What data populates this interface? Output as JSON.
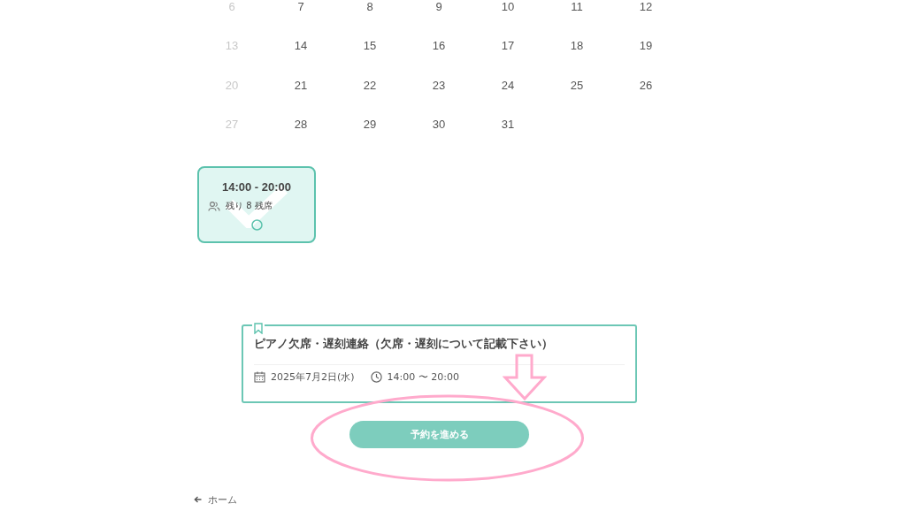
{
  "calendar": {
    "days": [
      {
        "label": "6",
        "disabled": true
      },
      {
        "label": "7",
        "disabled": false
      },
      {
        "label": "8",
        "disabled": false
      },
      {
        "label": "9",
        "disabled": false
      },
      {
        "label": "10",
        "disabled": false
      },
      {
        "label": "11",
        "disabled": false
      },
      {
        "label": "12",
        "disabled": false
      },
      {
        "label": "13",
        "disabled": true
      },
      {
        "label": "14",
        "disabled": false
      },
      {
        "label": "15",
        "disabled": false
      },
      {
        "label": "16",
        "disabled": false
      },
      {
        "label": "17",
        "disabled": false
      },
      {
        "label": "18",
        "disabled": false
      },
      {
        "label": "19",
        "disabled": false
      },
      {
        "label": "20",
        "disabled": true
      },
      {
        "label": "21",
        "disabled": false
      },
      {
        "label": "22",
        "disabled": false
      },
      {
        "label": "23",
        "disabled": false
      },
      {
        "label": "24",
        "disabled": false
      },
      {
        "label": "25",
        "disabled": false
      },
      {
        "label": "26",
        "disabled": false
      },
      {
        "label": "27",
        "disabled": true
      },
      {
        "label": "28",
        "disabled": false
      },
      {
        "label": "29",
        "disabled": false
      },
      {
        "label": "30",
        "disabled": false
      },
      {
        "label": "31",
        "disabled": false
      }
    ]
  },
  "time_slot": {
    "time": "14:00 - 20:00",
    "remaining": "残り 8 残席",
    "selected": true
  },
  "event": {
    "title": "ピアノ欠席・遅刻連絡（欠席・遅刻について記載下さい）",
    "date": "2025年7月2日(水)",
    "time": "14:00 〜 20:00"
  },
  "proceed_button": {
    "label": "予約を進める"
  },
  "back_link": {
    "label": "ホーム"
  }
}
